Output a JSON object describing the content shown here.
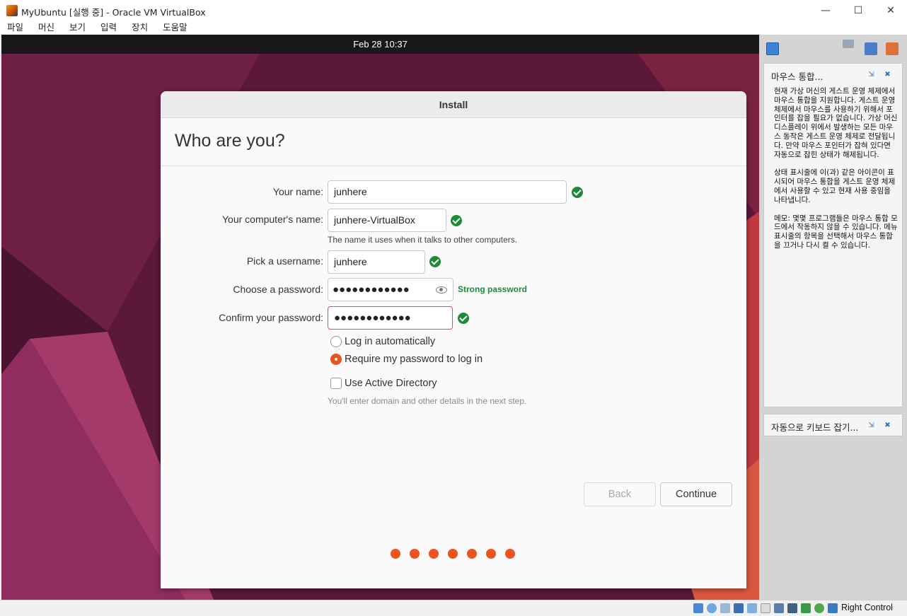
{
  "window": {
    "title": "MyUbuntu [실행 중] - Oracle VM VirtualBox",
    "minimize": "—",
    "maximize": "☐",
    "close": "✕"
  },
  "menu": [
    "파일",
    "머신",
    "보기",
    "입력",
    "장치",
    "도움말"
  ],
  "vm": {
    "clock": "Feb 28  10:37"
  },
  "installer": {
    "window_title": "Install",
    "heading": "Who are you?",
    "name_label": "Your name:",
    "name_value": "junhere",
    "computer_label": "Your computer's name:",
    "computer_value": "junhere-VirtualBox",
    "computer_hint": "The name it uses when it talks to other computers.",
    "username_label": "Pick a username:",
    "username_value": "junhere",
    "password_label": "Choose a password:",
    "password_value": "●●●●●●●●●●●●",
    "password_strength": "Strong password",
    "confirm_label": "Confirm your password:",
    "confirm_value": "●●●●●●●●●●●●",
    "login_auto": "Log in automatically",
    "login_require": "Require my password to log in",
    "login_selected": "require",
    "active_directory": "Use Active Directory",
    "active_directory_checked": false,
    "ad_hint": "You'll enter domain and other details in the next step.",
    "back_label": "Back",
    "continue_label": "Continue",
    "progress_steps": 7,
    "accent_color": "#e95420",
    "valid_color": "#1e8a37"
  },
  "side_panel": {
    "mouse_title": "마우스 통합...",
    "mouse_p1": "현재 가상 머신의 게스트 운영 체제에서 마우스 통합을 지원합니다. 게스트 운영 체제에서 마우스를 사용하기 위해서 포인터를 잡을 필요가 없습니다. 가상 머신 디스플레이 위에서 발생하는 모든 마우스 동작은 게스트 운영 체제로 전달됩니다. 만약 마우스 포인터가 잡혀 있다면 자동으로 잡힌 상태가 해제됩니다.",
    "mouse_p2": "상태 표시줄에 이(과) 같은 아이콘이 표시되어 마우스 통합을 게스트 운영 체제에서 사용할 수 있고 현재 사용 중임을 나타냅니다.",
    "mouse_p3": "메모: 몇몇 프로그램들은 마우스 통합 모드에서 작동하지 않을 수 있습니다. 메뉴 표시줄의 항목을 선택해서 마우스 통합을 끄거나 다시 켤 수 있습니다.",
    "keyboard_title": "자동으로 키보드 잡기..."
  },
  "statusbar": {
    "host_key": "Right Control"
  }
}
